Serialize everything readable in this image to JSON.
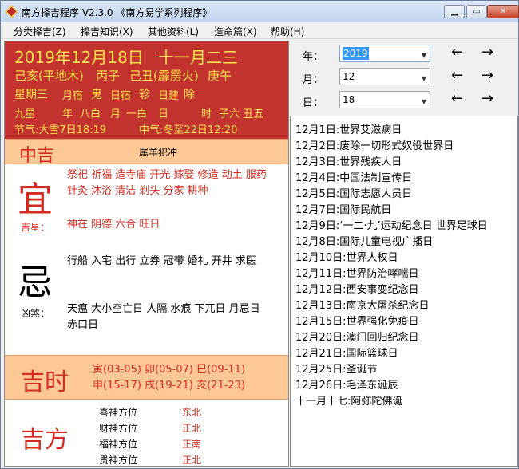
{
  "window": {
    "title": "南方择吉程序 V2.3.0 《南方易学系列程序》",
    "min_icon": "minimize-icon",
    "max_icon": "maximize-icon",
    "close_icon": "close-icon"
  },
  "menu": [
    "分类择吉(Z)",
    "择吉知识(X)",
    "其他资料(L)",
    "造命篇(X)",
    "帮助(H)"
  ],
  "date_info": {
    "solar_date": "2019年12月18日",
    "lunar_date": "十一月二三",
    "year_ganzhi": "己亥(平地木)",
    "month_ganzhi": "丙子",
    "day_ganzhi": "己丑(霹雳火)",
    "hour_ganzhi": "庚午",
    "weekday": "星期三",
    "month_star": "月宿",
    "month_star_value": "鬼",
    "day_star": "日宿",
    "day_star_value": "轸",
    "day_jian": "日建",
    "day_jian_value": "除",
    "nine_star": "九星",
    "year_star_label": "年",
    "year_star": "八白",
    "month_star9_label": "月",
    "month_star9": "一白",
    "day_star9_label": "日",
    "hour_star9_label": "时",
    "hour_star9": "子六 丑五",
    "solar_term_1": "节气:大雪7日18:19",
    "solar_term_2": "中气:冬至22日12:20"
  },
  "grade": "中吉",
  "clash": "属羊犯冲",
  "yi": {
    "char": "宜",
    "items_line1": "祭祀 祈福 造寺庙 开光 嫁娶 修造 动土 服药",
    "items_line2": "针灸 沐浴 清洁 剃头 分家 耕种",
    "lucky_label": "吉星：",
    "lucky_stars": "神在 阴德 六合 旺日"
  },
  "ji": {
    "char": "忌",
    "items": "行船 入宅 出行 立券 冠带 婚礼 开井 求医",
    "evil_label": "凶煞：",
    "evil_line1": "天瘟 大小空亡日 人隔 水痕 下兀日 月忌日",
    "evil_line2": "赤口日"
  },
  "ji_shi": {
    "title": "吉时",
    "line1": "寅(03-05) 卯(05-07) 巳(09-11)",
    "line2": "申(15-17) 戌(19-21) 亥(21-23)"
  },
  "ji_fang": {
    "title": "吉方",
    "rows": [
      {
        "label": "喜神方位",
        "value": "东北"
      },
      {
        "label": "财神方位",
        "value": "正北"
      },
      {
        "label": "福神方位",
        "value": "正南"
      },
      {
        "label": "贵神方位",
        "value": "正北"
      }
    ]
  },
  "selectors": {
    "year_label": "年：",
    "year_value": "2019",
    "month_label": "月：",
    "month_value": "12",
    "day_label": "日：",
    "day_value": "18",
    "prev": "←",
    "next": "→"
  },
  "events": [
    "12月1日:世界艾滋病日",
    "12月2日:废除一切形式奴役世界日",
    "12月3日:世界残疾人日",
    "12月4日:中国法制宣传日",
    "12月5日:国际志愿人员日",
    "12月7日:国际民航日",
    "12月9日:‘一二·九’运动纪念日 世界足球日",
    "12月8日:国际儿童电视广播日",
    "12月10日:世界人权日",
    "12月11日:世界防治哮喘日",
    "12月12日:西安事变纪念日",
    "12月13日:南京大屠杀纪念日",
    "12月15日:世界强化免疫日",
    "12月20日:澳门回归纪念日",
    "12月21日:国际篮球日",
    "12月25日:圣诞节",
    "12月26日:毛泽东诞辰",
    "十一月十七:阿弥陀佛诞"
  ]
}
